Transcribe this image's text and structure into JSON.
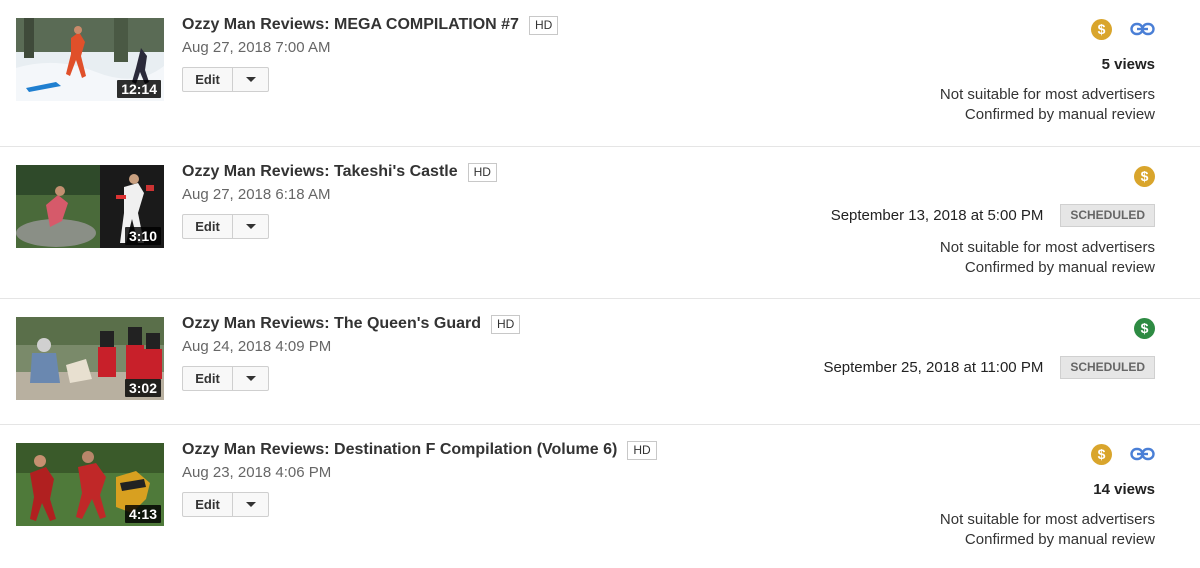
{
  "edit_label": "Edit",
  "colors": {
    "monetized_gold": "#d9a52c",
    "monetized_green": "#2e8b43",
    "link_blue": "#4a7fd6"
  },
  "videos": [
    {
      "title": "Ozzy Man Reviews: MEGA COMPILATION #7",
      "hd": "HD",
      "date": "Aug 27, 2018 7:00 AM",
      "duration": "12:14",
      "monetization_icon": "dollar-icon-gold",
      "dollar_symbol": "$",
      "link_icon": "link-icon",
      "views": "5 views",
      "ad_status": "Not suitable for most advertisers",
      "ad_review": "Confirmed by manual review"
    },
    {
      "title": "Ozzy Man Reviews: Takeshi's Castle",
      "hd": "HD",
      "date": "Aug 27, 2018 6:18 AM",
      "duration": "3:10",
      "monetization_icon": "dollar-icon-gold",
      "dollar_symbol": "$",
      "scheduled_date": "September 13, 2018 at 5:00 PM",
      "scheduled_badge": "SCHEDULED",
      "ad_status": "Not suitable for most advertisers",
      "ad_review": "Confirmed by manual review"
    },
    {
      "title": "Ozzy Man Reviews: The Queen's Guard",
      "hd": "HD",
      "date": "Aug 24, 2018 4:09 PM",
      "duration": "3:02",
      "monetization_icon": "dollar-icon-green",
      "dollar_symbol": "$",
      "scheduled_date": "September 25, 2018 at 11:00 PM",
      "scheduled_badge": "SCHEDULED"
    },
    {
      "title": "Ozzy Man Reviews: Destination F Compilation (Volume 6)",
      "hd": "HD",
      "date": "Aug 23, 2018 4:06 PM",
      "duration": "4:13",
      "monetization_icon": "dollar-icon-gold",
      "dollar_symbol": "$",
      "link_icon": "link-icon",
      "views": "14 views",
      "ad_status": "Not suitable for most advertisers",
      "ad_review": "Confirmed by manual review"
    }
  ]
}
